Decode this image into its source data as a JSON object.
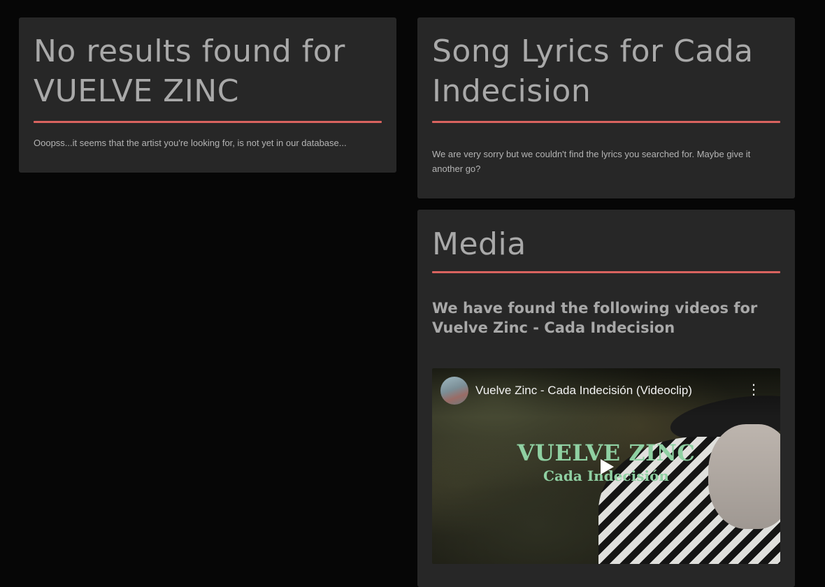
{
  "no_results": {
    "title": "No results found for VUELVE ZINC",
    "message": "Ooopss...it seems that the artist you're looking for, is not yet in our database..."
  },
  "lyrics": {
    "title": "Song Lyrics for Cada Indecision",
    "message": "We are very sorry but we couldn't find the lyrics you searched for. Maybe give it another go?"
  },
  "media": {
    "title": "Media",
    "subtitle": "We have found the following videos for Vuelve Zinc - Cada Indecision",
    "video": {
      "title": "Vuelve Zinc - Cada Indecisión (Videoclip)",
      "overlay_title": "VUELVE ZINC",
      "overlay_subtitle": "Cada Indecisión",
      "channel_avatar_icon": "channel-avatar",
      "menu_icon": "more-vert-icon",
      "play_icon": "play-icon"
    }
  },
  "colors": {
    "page_background": "#060606",
    "card_background": "#272727",
    "accent_rule": "#d9635f",
    "heading_text": "#a9a9a9",
    "body_text": "#b4b4b4",
    "overlay_text": "#8fd0a2"
  }
}
